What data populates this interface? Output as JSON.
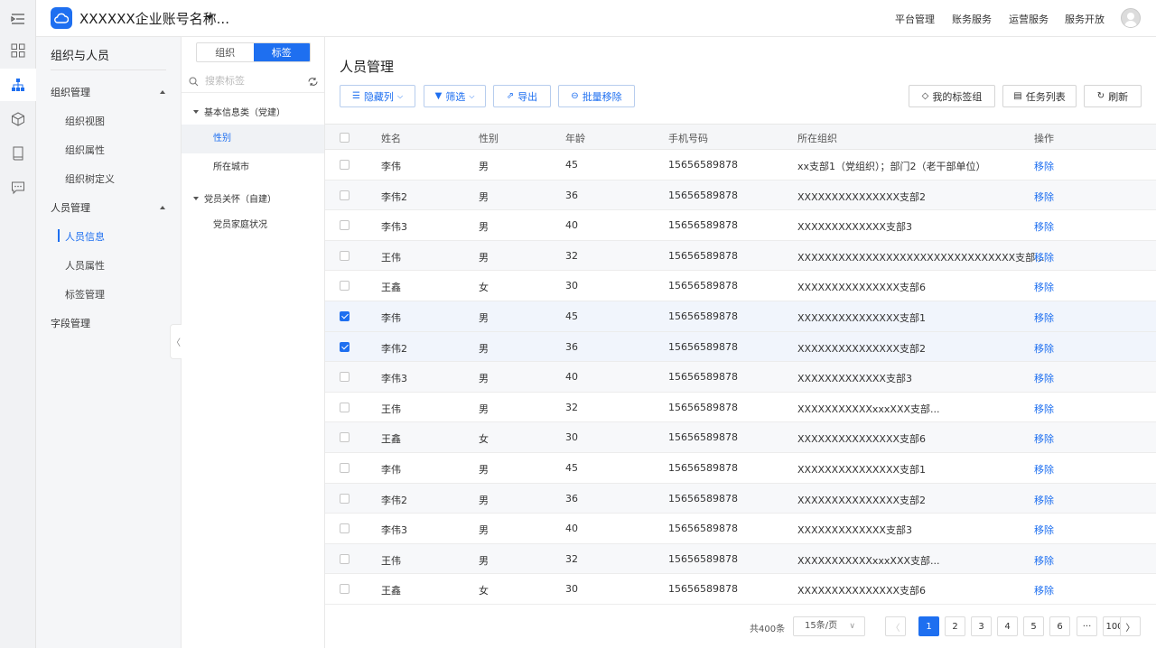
{
  "header": {
    "company": "XXXXXX企业账号名称...",
    "nav": [
      "平台管理",
      "账务服务",
      "运营服务",
      "服务开放"
    ]
  },
  "rail": {
    "icons": [
      "menu-collapse-icon",
      "grid-apps-icon",
      "org-tree-icon",
      "cube-icon",
      "book-icon",
      "message-icon"
    ]
  },
  "sidebar": {
    "title": "组织与人员",
    "groups": [
      {
        "label": "组织管理",
        "items": [
          "组织视图",
          "组织属性",
          "组织树定义"
        ]
      },
      {
        "label": "人员管理",
        "items": [
          "人员信息",
          "人员属性",
          "标签管理"
        ]
      },
      {
        "label": "字段管理",
        "items": []
      }
    ],
    "active_item": "人员信息"
  },
  "tag_panel": {
    "tabs": [
      "组织",
      "标签"
    ],
    "active_tab": "标签",
    "search_placeholder": "搜索标签",
    "tree": [
      {
        "label": "基本信息类（党建）",
        "children": [
          "性别",
          "所在城市"
        ]
      },
      {
        "label": "党员关怀（自建）",
        "children": [
          "党员家庭状况"
        ]
      }
    ],
    "active_leaf": "性别"
  },
  "main": {
    "title": "人员管理",
    "toolbar_left": [
      "隐藏列",
      "筛选",
      "导出",
      "批量移除"
    ],
    "toolbar_right": [
      "我的标签组",
      "任务列表",
      "刷新"
    ],
    "columns": [
      "姓名",
      "性别",
      "年龄",
      "手机号码",
      "所在组织",
      "操作"
    ],
    "rows": [
      {
        "name": "李伟",
        "gender": "男",
        "age": "45",
        "phone": "15656589878",
        "org": "xx支部1（党组织）；部门2（老干部单位）",
        "action": "移除",
        "checked": false
      },
      {
        "name": "李伟2",
        "gender": "男",
        "age": "36",
        "phone": "15656589878",
        "org": "XXXXXXXXXXXXXXX支部2",
        "action": "移除",
        "checked": false
      },
      {
        "name": "李伟3",
        "gender": "男",
        "age": "40",
        "phone": "15656589878",
        "org": "XXXXXXXXXXXXX支部3",
        "action": "移除",
        "checked": false
      },
      {
        "name": "王伟",
        "gender": "男",
        "age": "32",
        "phone": "15656589878",
        "org": "XXXXXXXXXXXXXXXXXXXXXXXXXXXXXXXX支部...",
        "action": "移除",
        "checked": false
      },
      {
        "name": "王鑫",
        "gender": "女",
        "age": "30",
        "phone": "15656589878",
        "org": "XXXXXXXXXXXXXXX支部6",
        "action": "移除",
        "checked": false
      },
      {
        "name": "李伟",
        "gender": "男",
        "age": "45",
        "phone": "15656589878",
        "org": "XXXXXXXXXXXXXXX支部1",
        "action": "移除",
        "checked": true
      },
      {
        "name": "李伟2",
        "gender": "男",
        "age": "36",
        "phone": "15656589878",
        "org": "XXXXXXXXXXXXXXX支部2",
        "action": "移除",
        "checked": true
      },
      {
        "name": "李伟3",
        "gender": "男",
        "age": "40",
        "phone": "15656589878",
        "org": "XXXXXXXXXXXXX支部3",
        "action": "移除",
        "checked": false
      },
      {
        "name": "王伟",
        "gender": "男",
        "age": "32",
        "phone": "15656589878",
        "org": "XXXXXXXXXXXxxxXXX支部...",
        "action": "移除",
        "checked": false
      },
      {
        "name": "王鑫",
        "gender": "女",
        "age": "30",
        "phone": "15656589878",
        "org": "XXXXXXXXXXXXXXX支部6",
        "action": "移除",
        "checked": false
      },
      {
        "name": "李伟",
        "gender": "男",
        "age": "45",
        "phone": "15656589878",
        "org": "XXXXXXXXXXXXXXX支部1",
        "action": "移除",
        "checked": false
      },
      {
        "name": "李伟2",
        "gender": "男",
        "age": "36",
        "phone": "15656589878",
        "org": "XXXXXXXXXXXXXXX支部2",
        "action": "移除",
        "checked": false
      },
      {
        "name": "李伟3",
        "gender": "男",
        "age": "40",
        "phone": "15656589878",
        "org": "XXXXXXXXXXXXX支部3",
        "action": "移除",
        "checked": false
      },
      {
        "name": "王伟",
        "gender": "男",
        "age": "32",
        "phone": "15656589878",
        "org": "XXXXXXXXXXXxxxXXX支部...",
        "action": "移除",
        "checked": false
      },
      {
        "name": "王鑫",
        "gender": "女",
        "age": "30",
        "phone": "15656589878",
        "org": "XXXXXXXXXXXXXXX支部6",
        "action": "移除",
        "checked": false
      }
    ]
  },
  "pagination": {
    "total": "共400条",
    "page_size": "15条/页",
    "prev": "〈",
    "next": "〉",
    "pages": [
      "1",
      "2",
      "3",
      "4",
      "5",
      "6",
      "···",
      "100"
    ],
    "current": "1"
  },
  "colors": {
    "accent": "#1e6ff0",
    "rail_bg": "#f1f2f4",
    "sidebar_bg": "#f5f6f8"
  }
}
